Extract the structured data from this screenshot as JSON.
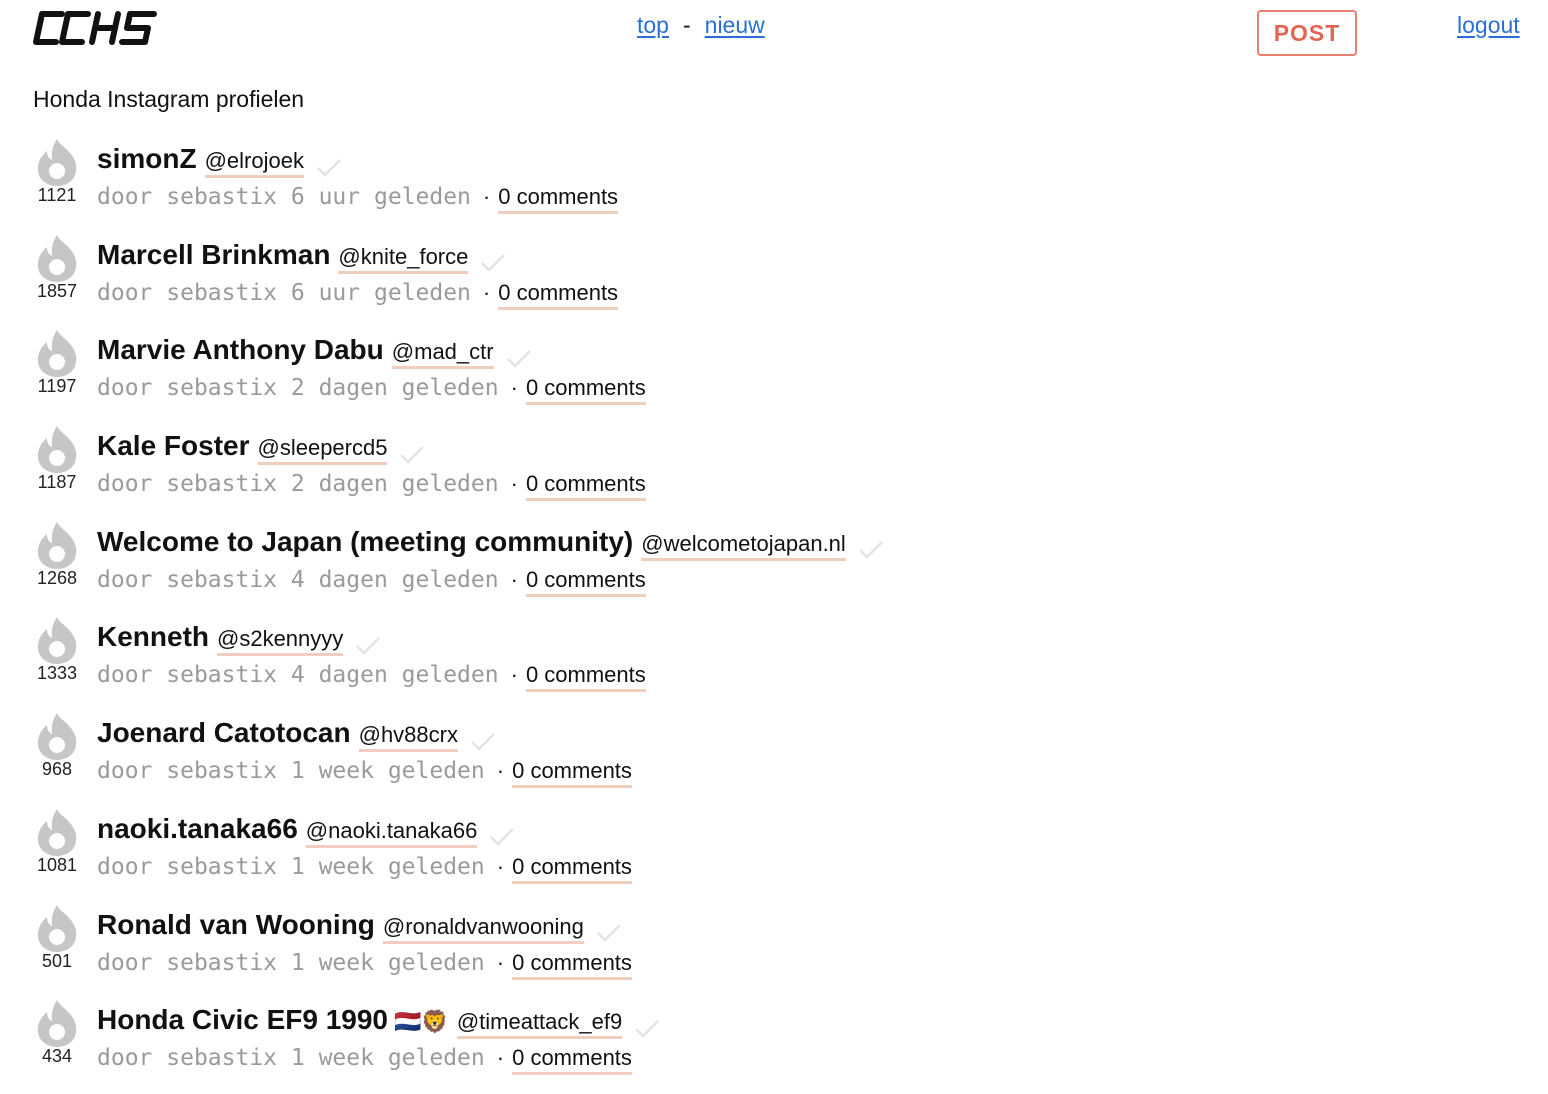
{
  "header": {
    "logo_text": "CCHS",
    "nav_top": "top",
    "nav_separator": "-",
    "nav_new": "nieuw",
    "post_button": "POST",
    "logout": "logout"
  },
  "page_title": "Honda Instagram profielen",
  "posts": [
    {
      "score": "1121",
      "title": "simonZ",
      "emoji": "",
      "handle": "@elrojoek",
      "by": "door",
      "user": "sebastix",
      "time": "6 uur geleden",
      "comments": "0 comments"
    },
    {
      "score": "1857",
      "title": "Marcell Brinkman",
      "emoji": "",
      "handle": "@knite_force",
      "by": "door",
      "user": "sebastix",
      "time": "6 uur geleden",
      "comments": "0 comments"
    },
    {
      "score": "1197",
      "title": "Marvie Anthony Dabu",
      "emoji": "",
      "handle": "@mad_ctr",
      "by": "door",
      "user": "sebastix",
      "time": "2 dagen geleden",
      "comments": "0 comments"
    },
    {
      "score": "1187",
      "title": "Kale Foster",
      "emoji": "",
      "handle": "@sleepercd5",
      "by": "door",
      "user": "sebastix",
      "time": "2 dagen geleden",
      "comments": "0 comments"
    },
    {
      "score": "1268",
      "title": "Welcome to Japan (meeting community)",
      "emoji": "",
      "handle": "@welcometojapan.nl",
      "by": "door",
      "user": "sebastix",
      "time": "4 dagen geleden",
      "comments": "0 comments"
    },
    {
      "score": "1333",
      "title": "Kenneth",
      "emoji": "",
      "handle": "@s2kennyyy",
      "by": "door",
      "user": "sebastix",
      "time": "4 dagen geleden",
      "comments": "0 comments"
    },
    {
      "score": "968",
      "title": "Joenard Catotocan",
      "emoji": "",
      "handle": "@hv88crx",
      "by": "door",
      "user": "sebastix",
      "time": "1 week geleden",
      "comments": "0 comments"
    },
    {
      "score": "1081",
      "title": "naoki.tanaka66",
      "emoji": "",
      "handle": "@naoki.tanaka66",
      "by": "door",
      "user": "sebastix",
      "time": "1 week geleden",
      "comments": "0 comments"
    },
    {
      "score": "501",
      "title": "Ronald van Wooning",
      "emoji": "",
      "handle": "@ronaldvanwooning",
      "by": "door",
      "user": "sebastix",
      "time": "1 week geleden",
      "comments": "0 comments"
    },
    {
      "score": "434",
      "title": "Honda Civic EF9 1990",
      "emoji": "🇳🇱🦁",
      "handle": "@timeattack_ef9",
      "by": "door",
      "user": "sebastix",
      "time": "1 week geleden",
      "comments": "0 comments"
    }
  ]
}
